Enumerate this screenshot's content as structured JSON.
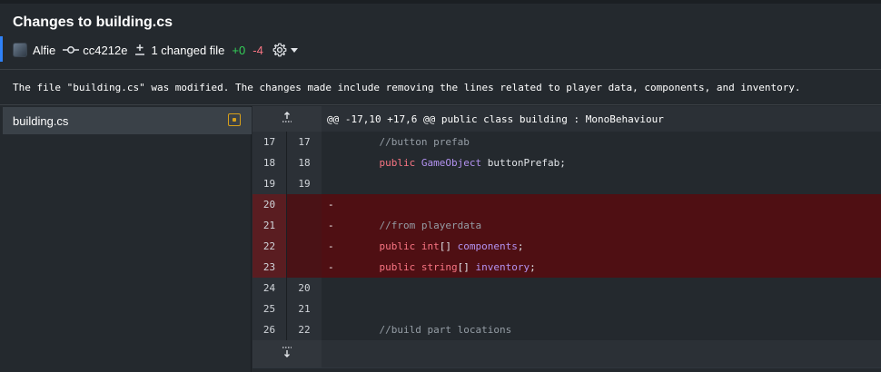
{
  "header": {
    "title": "Changes to building.cs",
    "author": "Alfie",
    "commit_sha": "cc4212e",
    "changed_files": "1 changed file",
    "additions": "+0",
    "deletions": "-4",
    "accent_color": "#2f81f7",
    "add_color": "#34d058",
    "del_color": "#f97583"
  },
  "summary": "The file \"building.cs\" was modified. The changes made include removing the lines related to player data, components, and inventory.",
  "sidebar": {
    "files": [
      {
        "name": "building.cs",
        "status": "modified",
        "status_color": "#d7a01a"
      }
    ]
  },
  "diff": {
    "hunk_header": "@@ -17,10 +17,6 @@ public class building : MonoBehaviour",
    "lines": [
      {
        "old": "17",
        "new": "17",
        "type": "context",
        "prefix": "",
        "tokens": [
          {
            "t": "    ",
            "c": "id"
          },
          {
            "t": "//button prefab",
            "c": "comment"
          }
        ]
      },
      {
        "old": "18",
        "new": "18",
        "type": "context",
        "prefix": "",
        "tokens": [
          {
            "t": "    ",
            "c": "id"
          },
          {
            "t": "public",
            "c": "kw"
          },
          {
            "t": " ",
            "c": "id"
          },
          {
            "t": "GameObject",
            "c": "type"
          },
          {
            "t": " buttonPrefab;",
            "c": "id"
          }
        ]
      },
      {
        "old": "19",
        "new": "19",
        "type": "context",
        "prefix": "",
        "tokens": []
      },
      {
        "old": "20",
        "new": "",
        "type": "del",
        "prefix": "-",
        "tokens": []
      },
      {
        "old": "21",
        "new": "",
        "type": "del",
        "prefix": "-",
        "tokens": [
          {
            "t": "    ",
            "c": "id"
          },
          {
            "t": "//from playerdata",
            "c": "comment"
          }
        ]
      },
      {
        "old": "22",
        "new": "",
        "type": "del",
        "prefix": "-",
        "tokens": [
          {
            "t": "    ",
            "c": "id"
          },
          {
            "t": "public",
            "c": "kw"
          },
          {
            "t": " ",
            "c": "id"
          },
          {
            "t": "int",
            "c": "kw"
          },
          {
            "t": "[] ",
            "c": "id"
          },
          {
            "t": "components",
            "c": "type"
          },
          {
            "t": ";",
            "c": "id"
          }
        ]
      },
      {
        "old": "23",
        "new": "",
        "type": "del",
        "prefix": "-",
        "tokens": [
          {
            "t": "    ",
            "c": "id"
          },
          {
            "t": "public",
            "c": "kw"
          },
          {
            "t": " ",
            "c": "id"
          },
          {
            "t": "string",
            "c": "kw"
          },
          {
            "t": "[] ",
            "c": "id"
          },
          {
            "t": "inventory",
            "c": "type"
          },
          {
            "t": ";",
            "c": "id"
          }
        ]
      },
      {
        "old": "24",
        "new": "20",
        "type": "context",
        "prefix": "",
        "tokens": []
      },
      {
        "old": "25",
        "new": "21",
        "type": "context",
        "prefix": "",
        "tokens": []
      },
      {
        "old": "26",
        "new": "22",
        "type": "context",
        "prefix": "",
        "tokens": [
          {
            "t": "    ",
            "c": "id"
          },
          {
            "t": "//build part locations",
            "c": "comment"
          }
        ]
      }
    ]
  }
}
